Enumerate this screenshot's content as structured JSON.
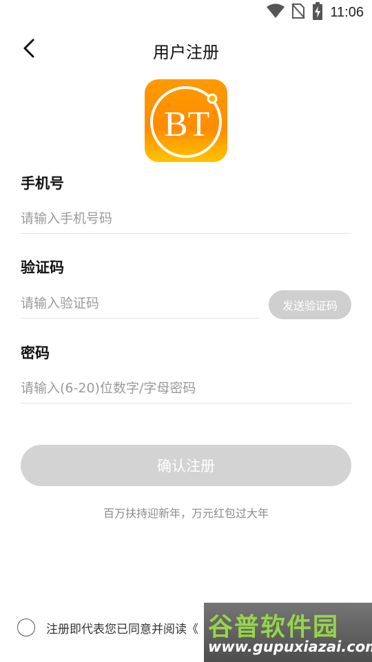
{
  "status_bar": {
    "time": "11:06",
    "icons": [
      "wifi-icon",
      "no-sim-icon",
      "battery-charging-icon"
    ]
  },
  "nav": {
    "back_icon": "chevron-left-icon",
    "title": "用户注册"
  },
  "logo": {
    "text": "BT",
    "colors": {
      "bg_top": "#ffb400",
      "bg_bottom": "#ff7a00",
      "ring": "#ffffff"
    }
  },
  "form": {
    "phone": {
      "label": "手机号",
      "placeholder": "请输入手机号码",
      "value": ""
    },
    "code": {
      "label": "验证码",
      "placeholder": "请输入验证码",
      "value": "",
      "send_button": "发送验证码"
    },
    "password": {
      "label": "密码",
      "placeholder": "请输入(6-20)位数字/字母密码",
      "value": ""
    },
    "submit_label": "确认注册"
  },
  "promo": "百万扶持迎新年，万元红包过大年",
  "agreement": {
    "text": "注册即代表您已同意并阅读",
    "link": "《",
    "checked": false
  },
  "watermark": {
    "title": "谷普软件园",
    "url": "www.gupuxiazai.com"
  },
  "colors": {
    "button_disabled": "#d3d3d3",
    "placeholder": "#9a9a9a",
    "divider": "#e3e3e3"
  }
}
